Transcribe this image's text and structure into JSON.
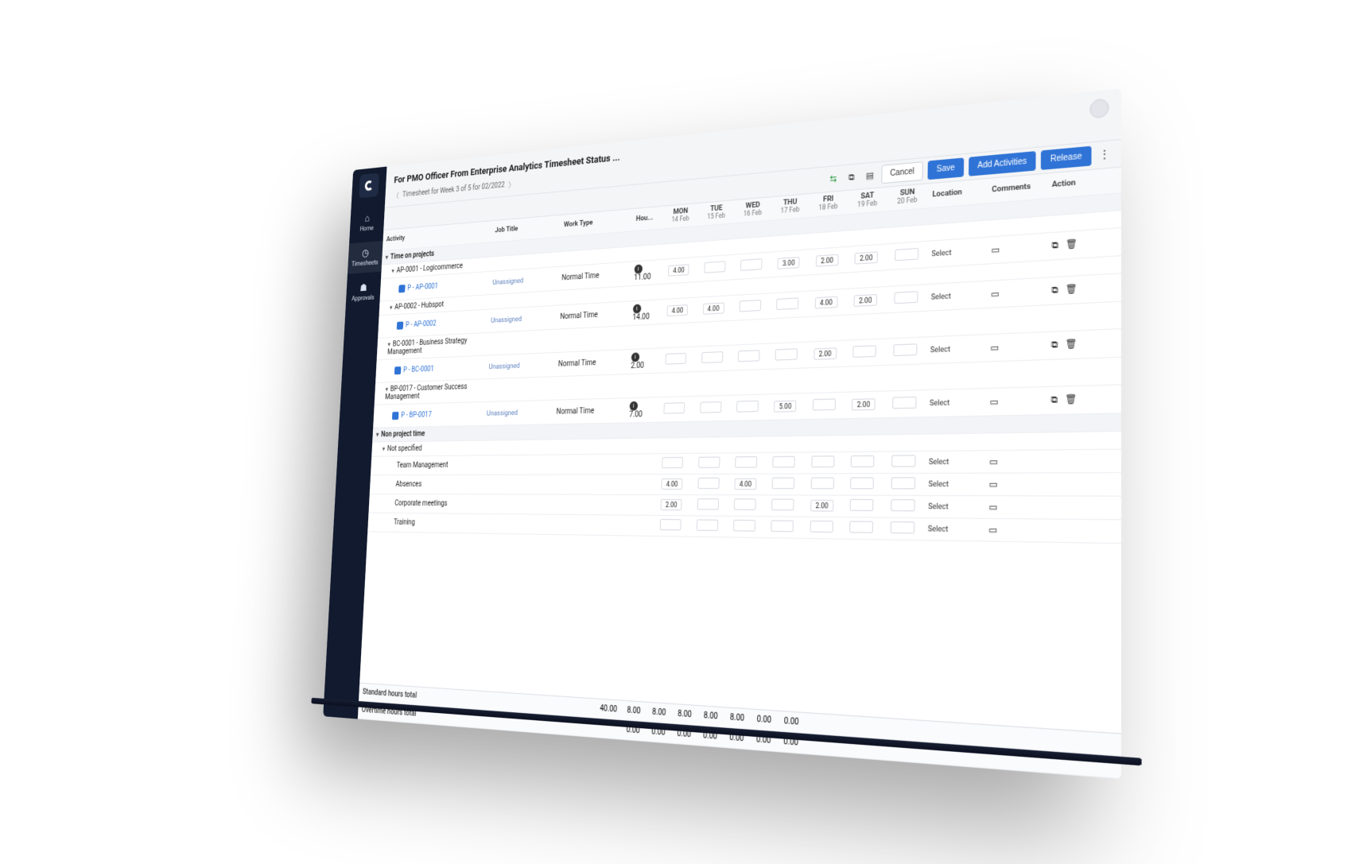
{
  "sidebar": {
    "items": [
      {
        "icon": "home",
        "label": "Home"
      },
      {
        "icon": "clock",
        "label": "Timesheets"
      },
      {
        "icon": "approve",
        "label": "Approvals"
      }
    ]
  },
  "header": {
    "title": "For PMO Officer From Enterprise Analytics Timesheet Status ...",
    "breadcrumb": "Timesheet for Week 3 of 5 for 02/2022"
  },
  "toolbar": {
    "cancel": "Cancel",
    "save": "Save",
    "add": "Add Activities",
    "release": "Release"
  },
  "columns": {
    "activity": "Activity",
    "job": "Job Title",
    "work": "Work Type",
    "hours": "Hou...",
    "days": [
      {
        "dow": "MON",
        "date": "14 Feb"
      },
      {
        "dow": "TUE",
        "date": "15 Feb"
      },
      {
        "dow": "WED",
        "date": "16 Feb"
      },
      {
        "dow": "THU",
        "date": "17 Feb"
      },
      {
        "dow": "FRI",
        "date": "18 Feb"
      },
      {
        "dow": "SAT",
        "date": "19 Feb"
      },
      {
        "dow": "SUN",
        "date": "20 Feb"
      }
    ],
    "location": "Location",
    "comments": "Comments",
    "action": "Action"
  },
  "labels": {
    "unassigned": "Unassigned",
    "normal": "Normal Time",
    "select": "Select"
  },
  "groups": {
    "timeOnProjects": "Time on projects",
    "nonProject": "Non project time",
    "notSpecified": "Not specified"
  },
  "projects": [
    {
      "code": "AP-0001 - Logicommerce",
      "task": "P - AP-0001",
      "hours": "11.00",
      "cells": [
        "4.00",
        "",
        "",
        "3.00",
        "2.00",
        "2.00",
        ""
      ]
    },
    {
      "code": "AP-0002 - Hubspot",
      "task": "P - AP-0002",
      "hours": "14.00",
      "cells": [
        "4.00",
        "4.00",
        "",
        "",
        "4.00",
        "2.00",
        ""
      ]
    },
    {
      "code": "BC-0001 - Business Strategy Management",
      "task": "P - BC-0001",
      "hours": "2.00",
      "cells": [
        "",
        "",
        "",
        "",
        "2.00",
        "",
        ""
      ]
    },
    {
      "code": "BP-0017 - Customer Success Management",
      "task": "P - BP-0017",
      "hours": "7.00",
      "cells": [
        "",
        "",
        "",
        "5.00",
        "",
        "2.00",
        ""
      ]
    }
  ],
  "nonproject": [
    {
      "name": "Team Management",
      "cells": [
        "",
        "",
        "",
        "",
        "",
        "",
        ""
      ]
    },
    {
      "name": "Absences",
      "cells": [
        "4.00",
        "",
        "4.00",
        "",
        "",
        "",
        ""
      ]
    },
    {
      "name": "Corporate meetings",
      "cells": [
        "2.00",
        "",
        "",
        "",
        "2.00",
        "",
        ""
      ]
    },
    {
      "name": "Training",
      "cells": [
        "",
        "",
        "",
        "",
        "",
        "",
        ""
      ]
    }
  ],
  "totals": {
    "standard": {
      "label": "Standard hours total",
      "sum": "40.00",
      "cells": [
        "8.00",
        "8.00",
        "8.00",
        "8.00",
        "8.00",
        "0.00",
        "0.00"
      ]
    },
    "overtime": {
      "label": "Overtime hours total",
      "cells": [
        "0.00",
        "0.00",
        "0.00",
        "0.00",
        "0.00",
        "0.00",
        "0.00"
      ]
    }
  }
}
